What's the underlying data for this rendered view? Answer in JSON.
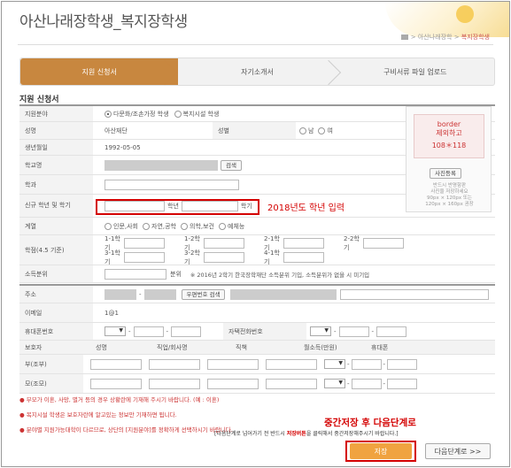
{
  "header": {
    "title": "아산나래장학생_복지장학생",
    "breadcrumb_parent": "아산나래장학",
    "breadcrumb_sep": ">",
    "breadcrumb_current": "복지장학생"
  },
  "steps": [
    {
      "label": "지원 신청서"
    },
    {
      "label": "자기소개서"
    },
    {
      "label": "구비서류 파일 업로드"
    }
  ],
  "section_title": "지원 신청서",
  "form": {
    "field_label": "지원분야",
    "field_opt1": "다문화/조손가정 학생",
    "field_opt2": "복지시설 학생",
    "name_label": "성명",
    "name_value": "아산재단",
    "gender_label": "성별",
    "gender_male": "남",
    "gender_female": "여",
    "birth_label": "생년월일",
    "birth_value": "1992-05-05",
    "school_label": "학교명",
    "search_btn": "검색",
    "major_label": "학과",
    "grade_label": "신규 학년 및 학기",
    "grade_unit": "학년",
    "term_unit": "학기",
    "track_label": "계열",
    "track_opts": [
      "인문,사회",
      "자연,공학",
      "의학,보건",
      "예체능"
    ],
    "gpa_label": "학점(4.5 기준)",
    "gpa_row1": [
      "1-1학기",
      "1-2학기",
      "2-1학기",
      "2-2학기"
    ],
    "gpa_row2": [
      "3-1학기",
      "3-2학기",
      "4-1학기"
    ],
    "income_label": "소득분위",
    "income_unit": "분위",
    "income_note": "※ 2016년 2학기 한국장학재단 소득분위 기입, 소득분위가 없을 시 미기입",
    "address_label": "주소",
    "postcode_btn": "우편번호 검색",
    "email_label": "이메일",
    "email_value": "1@1",
    "mobile_label": "휴대폰번호",
    "home_label": "자택전화번호",
    "dash": "-"
  },
  "guardian": {
    "headers": [
      "보호자",
      "성명",
      "직업/회사명",
      "직책",
      "월소득(만원)",
      "휴대폰"
    ],
    "rows": [
      "부(조부)",
      "모(조모)"
    ]
  },
  "photo": {
    "line1": "border",
    "line2": "제외하고",
    "line3": "108＊118",
    "register_btn": "사진등록",
    "note1": "반드시 반명함판",
    "note2": "사진을 저장하세요",
    "note3": "90px × 120px 또는",
    "note4": "120px × 160px 권장"
  },
  "callout": "2018년도 학년 입력",
  "notes": [
    "● 부모가 이혼, 사망, 별거 등의 경우 상황란에 기재해 주시기 바랍니다. (예 : 이혼)",
    "● 복지시설 학생은 보호자란에 알고있는 정보만 기재하면 됩니다.",
    "● 분야별 지원가능대학이 다르므로, 상단의 [지원분야]를 정확하게 선택하시기 바랍니다."
  ],
  "next_hint": "중간저장 후 다음단계로",
  "bottom_note_pre": "[다음단계로 넘어가기 전 반드시 ",
  "bottom_note_em": "저장버튼",
  "bottom_note_post": "을 클릭해서 중간저장해주시기 바랍니다.]",
  "buttons": {
    "save": "저장",
    "next": "다음단계로 >>"
  }
}
